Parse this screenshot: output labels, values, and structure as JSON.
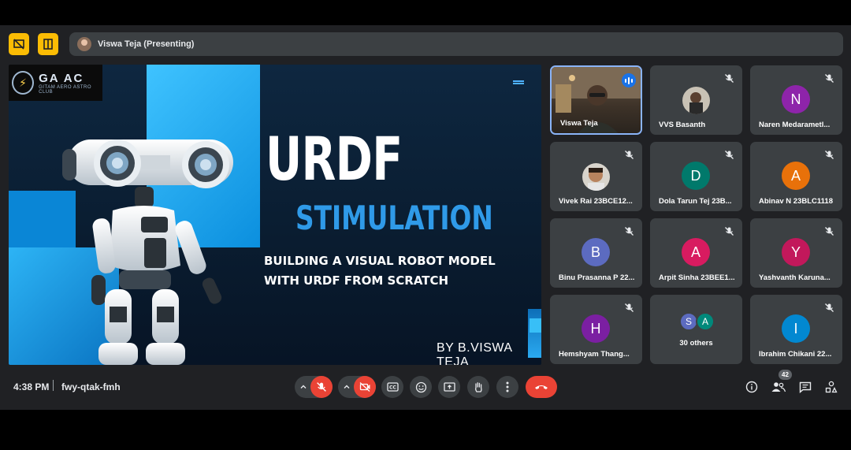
{
  "top_bar": {
    "presenter_label": "Viswa Teja (Presenting)"
  },
  "slide": {
    "logo_main": "GA AC",
    "logo_sub": "GITAM AERO ASTRO CLUB",
    "title": "URDF",
    "subtitle_big": "STIMULATION",
    "tagline_line1": "BUILDING A VISUAL ROBOT MODEL",
    "tagline_line2": "WITH URDF FROM SCRATCH",
    "byline": "BY B.VISWA TEJA"
  },
  "participants": [
    {
      "name": "Viswa Teja",
      "type": "video",
      "speaking": true
    },
    {
      "name": "VVS Basanth",
      "type": "photo",
      "muted": true
    },
    {
      "name": "Naren Medarametl...",
      "type": "letter",
      "letter": "N",
      "color": "#8e24aa",
      "muted": true
    },
    {
      "name": "Vivek Rai 23BCE12...",
      "type": "photo",
      "muted": true
    },
    {
      "name": "Dola Tarun Tej 23B...",
      "type": "letter",
      "letter": "D",
      "color": "#00796b",
      "muted": true
    },
    {
      "name": "Abinav N 23BLC1118",
      "type": "letter",
      "letter": "A",
      "color": "#e8710a",
      "muted": true
    },
    {
      "name": "Binu Prasanna P 22...",
      "type": "letter",
      "letter": "B",
      "color": "#5c6bc0",
      "muted": true
    },
    {
      "name": "Arpit Sinha 23BEE1...",
      "type": "letter",
      "letter": "A",
      "color": "#d81b60",
      "muted": true
    },
    {
      "name": "Yashvanth Karuna...",
      "type": "letter",
      "letter": "Y",
      "color": "#c2185b",
      "muted": true
    },
    {
      "name": "Hemshyam Thang...",
      "type": "letter",
      "letter": "H",
      "color": "#7b1fa2",
      "muted": true
    },
    {
      "name": "30 others",
      "type": "others",
      "letters": [
        "S",
        "A"
      ],
      "colors": [
        "#5c6bc0",
        "#00897b"
      ]
    },
    {
      "name": "Ibrahim Chikani 22...",
      "type": "letter",
      "letter": "I",
      "color": "#0288d1",
      "muted": true
    }
  ],
  "bottom_bar": {
    "time": "4:38 PM",
    "meeting_code": "fwy-qtak-fmh",
    "people_count": "42",
    "controls": [
      "mic-off-icon",
      "camera-off-icon",
      "captions-icon",
      "emoji-icon",
      "present-icon",
      "raise-hand-icon",
      "more-icon",
      "end-call-icon"
    ],
    "right_controls": [
      "info-icon",
      "people-icon",
      "chat-icon",
      "activities-icon"
    ]
  },
  "colors": {
    "background": "#202124",
    "tile": "#3c4043",
    "accent_red": "#ea4335",
    "accent_yellow": "#fbbc04",
    "slide_blue": "#2f9ae8"
  }
}
